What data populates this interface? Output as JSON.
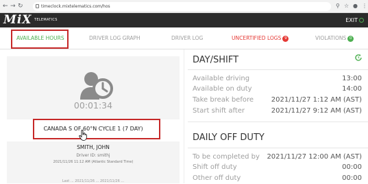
{
  "browser": {
    "url": "timeclock.mixtelematics.com/hos",
    "back_icon": "back-arrow-icon",
    "forward_icon": "forward-arrow-icon",
    "reload_icon": "reload-icon"
  },
  "app": {
    "logo_text": "MiX",
    "logo_sub": "TELEMATICS",
    "exit_label": "EXIT"
  },
  "tabs": [
    {
      "label": "AVAILABLE HOURS",
      "active": true
    },
    {
      "label": "DRIVER LOG GRAPH"
    },
    {
      "label": "DRIVER LOG"
    },
    {
      "label": "UNCERTIFIED LOGS",
      "badge": "9"
    },
    {
      "label": "VIOLATIONS",
      "badge": "0"
    }
  ],
  "driver_card": {
    "timer": "00:01:34",
    "cycle": "CANADA S OF 60°N CYCLE 1 (7 DAY)",
    "name": "SMITH, JOHN",
    "driver_id": "Driver ID: smithj",
    "timestamp": "2021/11/26 11:12 AM (Atlantic Standard Time)",
    "footer": "Last ... 2021/11/26 ... 2021/11/26 ..."
  },
  "day_shift": {
    "title": "DAY/SHIFT",
    "rows": [
      {
        "label": "Available driving",
        "value": "13:00"
      },
      {
        "label": "Available on duty",
        "value": "14:00"
      },
      {
        "label": "Take break before",
        "value": "2021/11/27 1:12 AM (AST)"
      },
      {
        "label": "Start shift after",
        "value": "2021/11/27 9:12 AM (AST)"
      }
    ]
  },
  "daily_off_duty": {
    "title": "DAILY OFF DUTY",
    "rows": [
      {
        "label": "To be completed by",
        "value": "2021/11/27 12:00 AM (AST)"
      },
      {
        "label": "Shift off duty",
        "value": "00:00"
      },
      {
        "label": "Other off duty",
        "value": "00:00"
      }
    ]
  },
  "colors": {
    "accent_green": "#4caf50",
    "alert_red": "#e53935",
    "highlight_box": "#c62828",
    "appbar": "#2b2b2b"
  }
}
